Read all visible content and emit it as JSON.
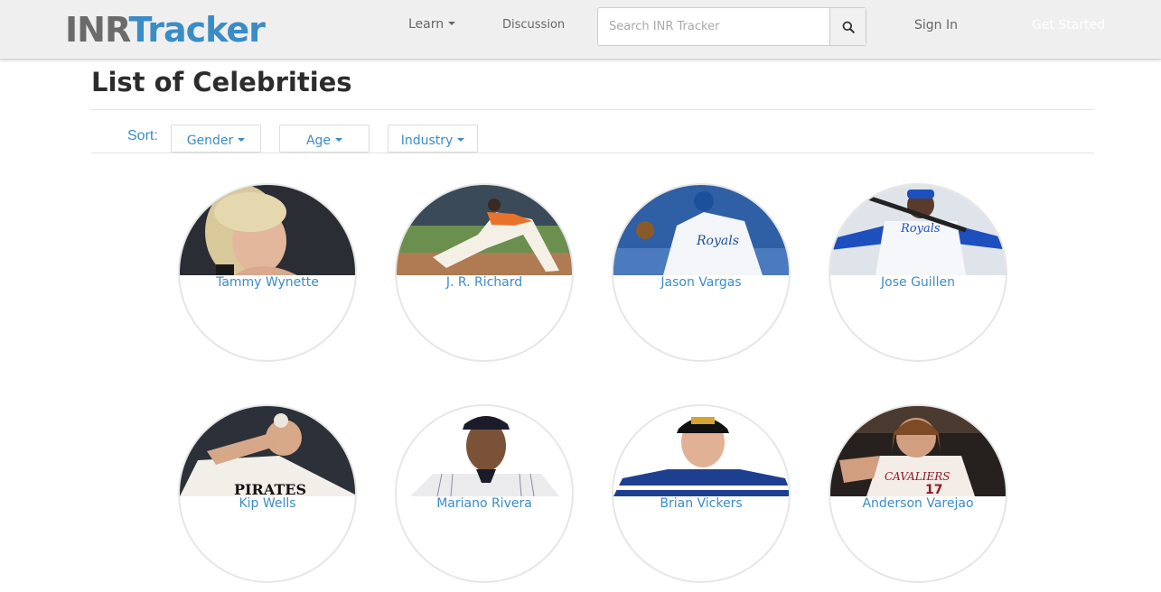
{
  "brand": {
    "part1": "INR",
    "part2": "Tracker"
  },
  "nav": {
    "learn": "Learn",
    "discussion": "Discussion",
    "search_placeholder": "Search INR Tracker",
    "sign_in": "Sign In",
    "get_started": "Get Started"
  },
  "page": {
    "title": "List of Celebrities"
  },
  "sort": {
    "label": "Sort:",
    "options": [
      "Gender",
      "Age",
      "Industry"
    ]
  },
  "celebrities": [
    {
      "name": "Tammy Wynette"
    },
    {
      "name": "J. R. Richard"
    },
    {
      "name": "Jason Vargas"
    },
    {
      "name": "Jose Guillen"
    },
    {
      "name": "Kip Wells"
    },
    {
      "name": "Mariano Rivera"
    },
    {
      "name": "Brian Vickers"
    },
    {
      "name": "Anderson Varejao"
    }
  ],
  "colors": {
    "accent": "#3a8cc6",
    "navbar_bg": "#efefef"
  }
}
